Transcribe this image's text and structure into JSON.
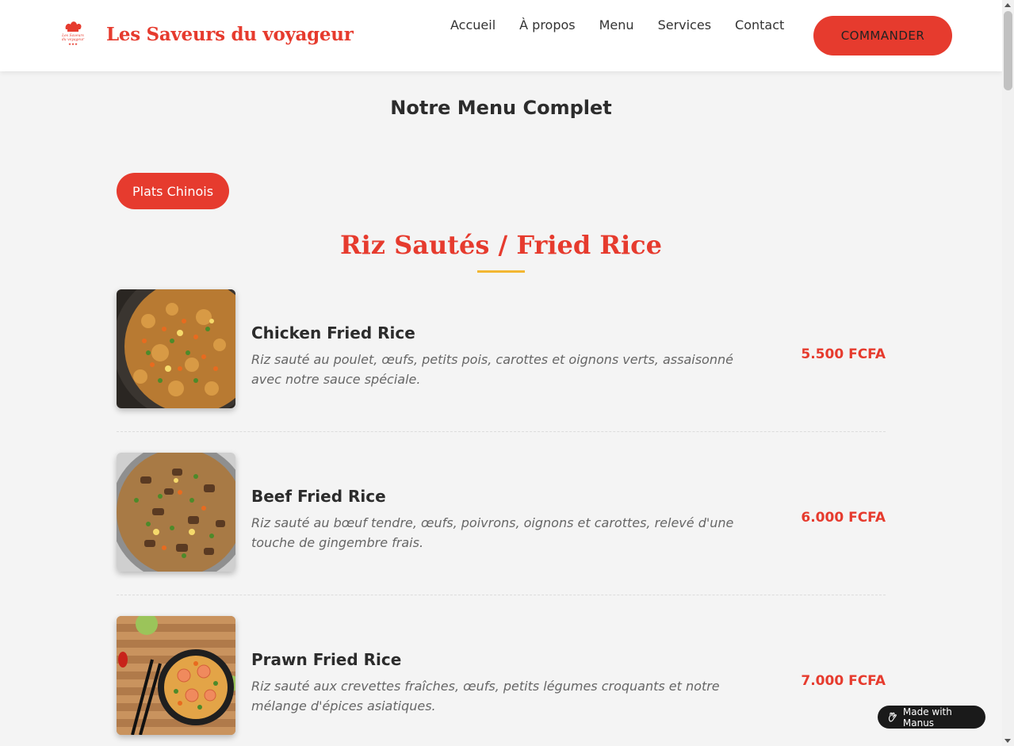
{
  "header": {
    "brand": "Les Saveurs du voyageur",
    "logo_text": "Les Saveurs du voyageur",
    "nav": [
      "Accueil",
      "À propos",
      "Menu",
      "Services",
      "Contact"
    ],
    "cta_label": "COMMANDER"
  },
  "main": {
    "page_title": "Notre Menu Complet",
    "category_tab": "Plats Chinois",
    "section_title": "Riz Sautés / Fried Rice",
    "items": [
      {
        "name": "Chicken Fried Rice",
        "description": "Riz sauté au poulet, œufs, petits pois, carottes et oignons verts, assaisonné avec notre sauce spéciale.",
        "price": "5.500 FCFA",
        "image": "chicken-fried-rice-photo"
      },
      {
        "name": "Beef Fried Rice",
        "description": "Riz sauté au bœuf tendre, œufs, poivrons, oignons et carottes, relevé d'une touche de gingembre frais.",
        "price": "6.000 FCFA",
        "image": "beef-fried-rice-photo"
      },
      {
        "name": "Prawn Fried Rice",
        "description": "Riz sauté aux crevettes fraîches, œufs, petits légumes croquants et notre mélange d'épices asiatiques.",
        "price": "7.000 FCFA",
        "image": "prawn-fried-rice-photo"
      }
    ]
  },
  "badge": {
    "label": "Made with Manus",
    "icon": "manus-icon"
  },
  "colors": {
    "accent": "#e63b2e",
    "underline": "#f2b632",
    "background": "#f4f4f4"
  }
}
